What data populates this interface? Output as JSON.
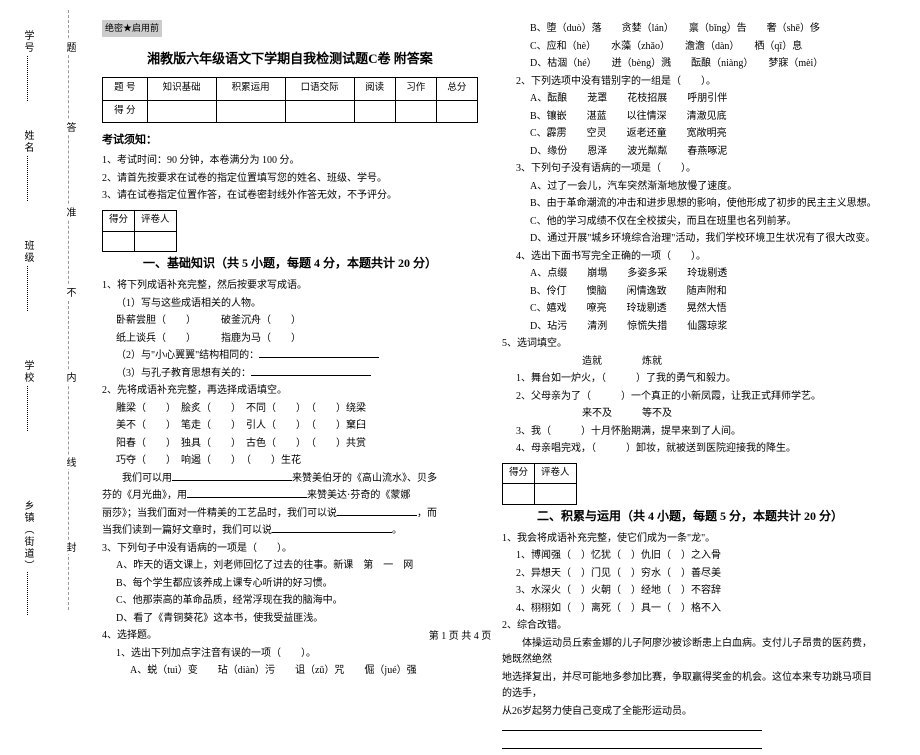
{
  "secret": "绝密★启用前",
  "title": "湘教版六年级语文下学期自我检测试题C卷 附答案",
  "scoreTable": {
    "h0": "题 号",
    "h1": "知识基础",
    "h2": "积累运用",
    "h3": "口语交际",
    "h4": "阅读",
    "h5": "习作",
    "h6": "总分",
    "r0": "得 分"
  },
  "binding": {
    "f1": "学号",
    "f2": "姓名",
    "f3": "班级",
    "f4": "学校",
    "f5": "乡镇（街道）",
    "seal1": "题",
    "seal2": "答",
    "seal3": "准",
    "seal4": "不",
    "seal5": "内",
    "seal6": "线",
    "seal7": "封"
  },
  "notice": {
    "head": "考试须知：",
    "n1": "1、考试时间：90 分钟，本卷满分为 100 分。",
    "n2": "2、请首先按要求在试卷的指定位置填写您的姓名、班级、学号。",
    "n3": "3、请在试卷指定位置作答，在试卷密封线外作答无效，不予评分。"
  },
  "scoreBox": {
    "c1": "得分",
    "c2": "评卷人"
  },
  "part1": {
    "title": "一、基础知识（共 5 小题，每题 4 分，本题共计 20 分）",
    "q1": "1、将下列成语补充完整，然后按要求写成语。",
    "q1a": "（1）写与这些成语相关的人物。",
    "q1a1": "卧薪尝胆（　　）　　　破釜沉舟（　　）",
    "q1a2": "纸上谈兵（　　）　　　指鹿为马（　　）",
    "q1b": "（2）与\"小心翼翼\"结构相同的：",
    "q1c": "（3）与孔子教育思想有关的：",
    "q2": "2、先将成语补充完整，再选择成语填空。",
    "q2a": "雕梁（　　）　脍炙（　　）　不同（　　）　（　　）绕梁",
    "q2b": "美不（　　）　笔走（　　）　引人（　　）　（　　）窠臼",
    "q2c": "阳春（　　）　独具（　　）　古色（　　）　（　　）共赏",
    "q2d": "巧夺（　　）　响遏（　　）　（　　）生花",
    "q2e_pre": "　　我们可以用",
    "q2e_mid": "来赞美伯牙的《高山流水》、贝多",
    "q2f": "芬的《月光曲》，用",
    "q2f_mid": "来赞美达·芬奇的《蒙娜",
    "q2g": "丽莎》；当我们面对一件精美的工艺品时，我们可以说",
    "q2g_end": "，而",
    "q2h": "当我们读到一篇好文章时，我们可以说",
    "q2h_end": "。",
    "q3": "3、下列句子中没有语病的一项是（　　）。",
    "q3a": "A、昨天的语文课上，刘老师回忆了过去的往事。新课　第　一　网",
    "q3b": "B、每个学生都应该养成上课专心听讲的好习惯。",
    "q3c": "C、他那崇高的革命品质，经常浮现在我的脑海中。",
    "q3d": "D、看了《青铜葵花》这本书，使我受益匪浅。",
    "q4": "4、选择题。",
    "q4a": "1、选出下列加点字注音有误的一项（　　）。",
    "q4a1": "A、蜕（tuì）变　　玷（diàn）污　　诅（zǔ）咒　　倔（jué）强"
  },
  "col2": {
    "l1": "B、堕（duò）落　　贪婪（lán）　　禀（bǐng）告　　奢（shē）侈",
    "l2": "C、应和（hè）　　水藻（zhǎo）　　澹澹（dàn）　　栖（qī）息",
    "l3": "D、枯涸（hé）　　迸（bèng）溅　　酝酿（niàng）　　梦寐（mèi）",
    "l4": "2、下列选项中没有错别字的一组是（　　）。",
    "l4a": "A、酝酿　　茏罩　　花枝招展　　呼朋引伴",
    "l4b": "B、镶嵌　　湛蓝　　以往情深　　清澈见底",
    "l4c": "C、霹雳　　空灵　　返老还童　　宽敞明亮",
    "l4d": "D、缘份　　恩泽　　波光粼粼　　春燕啄泥",
    "l5": "3、下列句子没有语病的一项是（　　）。",
    "l5a": "A、过了一会儿，汽车突然渐渐地放慢了速度。",
    "l5b": "B、由于革命潮流的冲击和进步思想的影响，使他形成了初步的民主主义思想。",
    "l5c": "C、他的学习成绩不仅在全校拔尖，而且在班里也名列前茅。",
    "l5d": "D、通过开展\"城乡环境综合治理\"活动，我们学校环境卫生状况有了很大改变。",
    "l6": "4、选出下面书写完全正确的一项（　　）。",
    "l6a": "A、点缀　　崩塌　　多姿多采　　玲珑剔透",
    "l6b": "B、伶仃　　懊脑　　闲情逸致　　随声附和",
    "l6c": "C、嬉戏　　嘹亮　　玲珑剔透　　晃然大悟",
    "l6d": "D、玷污　　清洌　　惊慌失措　　仙露琼浆",
    "l7": "5、选词填空。",
    "l7w": "　　　　　　　　造就　　　　炼就",
    "l7a_pre": "1、舞台如一炉火，（　　　）了我的勇气和毅力。",
    "l7b": "2、父母亲为了（　　　）一个真正的小新凤霞，让我正式拜师学艺。",
    "l7w2": "　　　　　　　　来不及　　　等不及",
    "l7c": "3、我（　　　）十月怀胎期满，提早来到了人间。",
    "l7d": "4、母亲唱完戏，（　　　）卸妆，就被送到医院迎接我的降生。"
  },
  "part2": {
    "title": "二、积累与运用（共 4 小题，每题 5 分，本题共计 20 分）",
    "q1": "1、我会将成语补充完整，使它们成为一条\"龙\"。",
    "q1a": "1、博闻强（　）忆犹（　）仇旧（　）之入骨",
    "q1b": "2、异想天（　）门见（　）穷水（　）善尽美",
    "q1c": "3、水深火（　）火朝（　）经地（　）不容辞",
    "q1d": "4、栩栩如（　）离死（　）具一（　）格不入",
    "q2": "2、综合改错。",
    "q2a": "　　体操运动员丘索金娜的儿子阿廖沙被诊断患上白血病。支付儿子昂贵的医药费，她既然绝然",
    "q2b": "地选择复出，并尽可能地多参加比赛，争取赢得奖金的机会。这位本来专功跳马项目的选手，",
    "q2c": "从26岁起努力使自己变成了全能形运动员。"
  },
  "footer": "第 1 页 共 4 页"
}
